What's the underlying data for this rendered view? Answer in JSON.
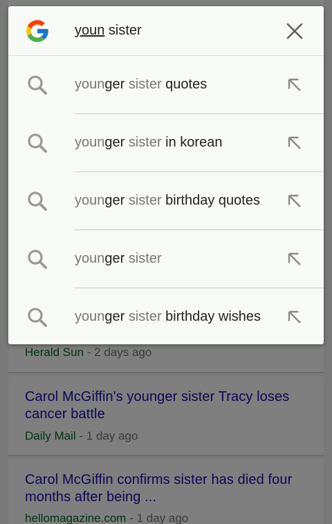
{
  "search": {
    "typed": "youn",
    "remainder": " sister",
    "clear_icon": "close-icon",
    "logo": "google-g-logo"
  },
  "suggestions": [
    {
      "prefix": "youn",
      "mid": "ger",
      "tail": " sister",
      "extra": " quotes"
    },
    {
      "prefix": "youn",
      "mid": "ger",
      "tail": " sister",
      "extra": " in korean"
    },
    {
      "prefix": "youn",
      "mid": "ger",
      "tail": " sister",
      "extra": " birthday quotes"
    },
    {
      "prefix": "youn",
      "mid": "ger",
      "tail": " sister",
      "extra": ""
    },
    {
      "prefix": "youn",
      "mid": "ger",
      "tail": " sister",
      "extra": " birthday wishes"
    }
  ],
  "results": [
    {
      "headline": "",
      "source": "Herald Sun",
      "age": " - 2 days ago"
    },
    {
      "headline": "Carol McGiffin's younger sister Tracy loses cancer battle",
      "source": "Daily Mail",
      "age": " - 1 day ago"
    },
    {
      "headline": "Carol McGiffin confirms sister has died four months after being ...",
      "source": "hellomagazine.com",
      "age": " - 1 day ago"
    }
  ],
  "colors": {
    "link": "#1a0dab",
    "source": "#006621",
    "panel_bg": "#f7faf7"
  }
}
